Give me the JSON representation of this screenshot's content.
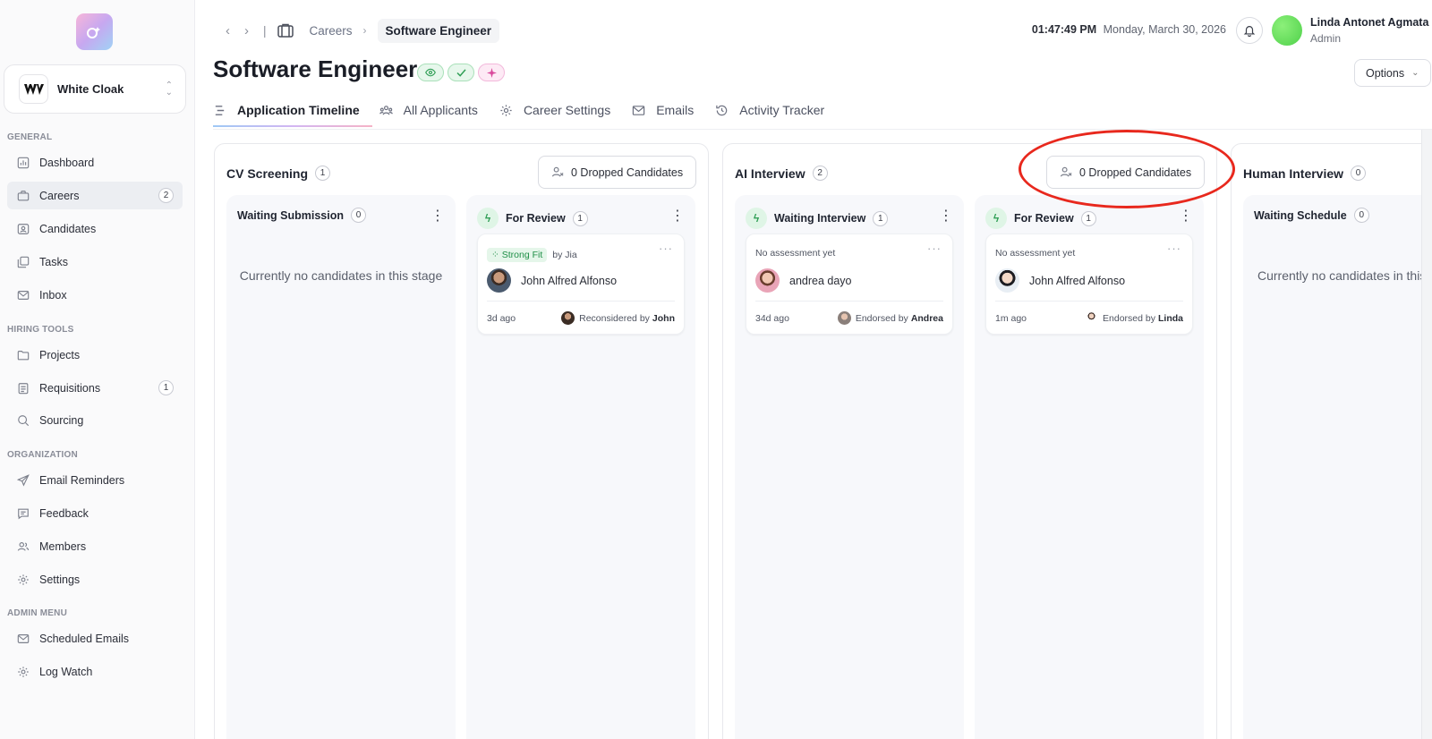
{
  "sidebar": {
    "org_name": "White Cloak",
    "org_logo_text": "W",
    "sections": {
      "general": "GENERAL",
      "hiring_tools": "HIRING TOOLS",
      "organization": "ORGANIZATION",
      "admin_menu": "ADMIN MENU"
    },
    "items": {
      "dashboard": "Dashboard",
      "careers": "Careers",
      "careers_badge": "2",
      "candidates": "Candidates",
      "tasks": "Tasks",
      "inbox": "Inbox",
      "projects": "Projects",
      "requisitions": "Requisitions",
      "requisitions_badge": "1",
      "sourcing": "Sourcing",
      "email_reminders": "Email Reminders",
      "feedback": "Feedback",
      "members": "Members",
      "settings": "Settings",
      "scheduled_emails": "Scheduled Emails",
      "log_watch": "Log Watch"
    }
  },
  "header": {
    "breadcrumb_parent": "Careers",
    "breadcrumb_current": "Software Engineer",
    "time": "01:47:49 PM",
    "date": "Monday, March 30, 2026",
    "user_name": "Linda Antonet Agmata",
    "user_role": "Admin",
    "options_label": "Options"
  },
  "page": {
    "title": "Software Engineer",
    "tabs": {
      "timeline": "Application Timeline",
      "applicants": "All Applicants",
      "settings": "Career Settings",
      "emails": "Emails",
      "activity": "Activity Tracker"
    }
  },
  "board": {
    "cv": {
      "title": "CV Screening",
      "count": "1",
      "dropped": "0 Dropped Candidates",
      "waiting": {
        "title": "Waiting Submission",
        "count": "0",
        "empty": "Currently no candidates in this stage"
      },
      "review": {
        "title": "For Review",
        "count": "1",
        "card": {
          "tag": "Strong Fit",
          "by": "by Jia",
          "name": "John Alfred Alfonso",
          "age": "3d ago",
          "action": "Reconsidered by",
          "actor": "John"
        }
      }
    },
    "ai": {
      "title": "AI Interview",
      "count": "2",
      "dropped": "0 Dropped Candidates",
      "waiting": {
        "title": "Waiting Interview",
        "count": "1",
        "card": {
          "note": "No assessment yet",
          "name": "andrea dayo",
          "age": "34d ago",
          "action": "Endorsed by",
          "actor": "Andrea"
        }
      },
      "review": {
        "title": "For Review",
        "count": "1",
        "card": {
          "note": "No assessment yet",
          "name": "John Alfred Alfonso",
          "age": "1m ago",
          "action": "Endorsed by",
          "actor": "Linda"
        }
      }
    },
    "human": {
      "title": "Human Interview",
      "count": "0",
      "waiting": {
        "title": "Waiting Schedule",
        "count": "0",
        "empty": "Currently no candidates in this stage"
      }
    }
  },
  "colors": {
    "accent_green": "#2f9e55",
    "annotation_red": "#e8281d",
    "active_nav": "#eceef2"
  }
}
